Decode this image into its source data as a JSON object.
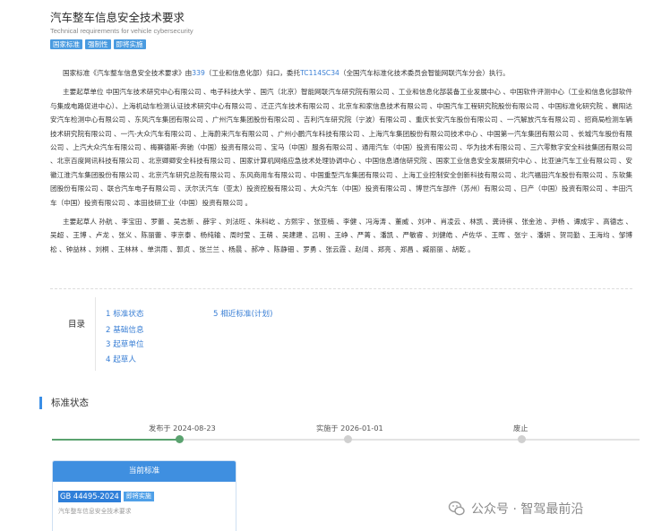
{
  "header": {
    "title_cn": "汽车整车信息安全技术要求",
    "title_en": "Technical requirements for vehicle cybersecurity",
    "tags": [
      "国家标准",
      "强制性",
      "即将实施"
    ]
  },
  "intro": {
    "p1_a": "国家标准《汽车整车信息安全技术要求》由",
    "p1_tc": "339",
    "p1_b": "（工业和信息化部）归口，委托",
    "p1_tc2": "TC114SC34",
    "p1_c": "（全国汽车标准化技术委员会智能网联汽车分会）执行。",
    "p2": "主要起草单位 中国汽车技术研究中心有限公司 、电子科技大学 、国汽（北京）智能网联汽车研究院有限公司 、工业和信息化部装备工业发展中心 、中国软件评测中心（工业和信息化部软件与集成电路促进中心）、上海机动车检测认证技术研究中心有限公司 、迁正汽车技术有限公司 、北京车和家信息技术有限公司 、中国汽车工程研究院股份有限公司 、中国标准化研究院 、襄阳达安汽车检测中心有限公司 、东风汽车集团有限公司 、广州汽车集团股份有限公司 、吉利汽车研究院（宁波）有限公司 、重庆长安汽车股份有限公司 、一汽解放汽车有限公司 、招商局检测车辆技术研究院有限公司 、一汽-大众汽车有限公司 、上海蔚来汽车有限公司 、广州小鹏汽车科技有限公司 、上海汽车集团股份有限公司技术中心 、中国第一汽车集团有限公司 、长城汽车股份有限公司 、上汽大众汽车有限公司 、梅赛德斯-奔驰（中国）投资有限公司 、宝马（中国）服务有限公司 、通用汽车（中国）投资有限公司 、华为技术有限公司 、三六零数字安全科技集团有限公司 、北京百度网讯科技有限公司 、北京卿卿安全科技有限公司 、国家计算机网络应急技术处理协调中心 、中国信息通信研究院 、国家工业信息安全发展研究中心 、比亚迪汽车工业有限公司 、安徽江淮汽车集团股份有限公司 、北京汽车研究总院有限公司 、东风商用车有限公司 、中国重型汽车集团有限公司 、上海工业控制安全创新科技有限公司 、北汽福田汽车股份有限公司 、东软集团股份有限公司 、联合汽车电子有限公司 、沃尔沃汽车（亚太）投资控股有限公司 、大众汽车（中国）投资有限公司 、博世汽车部件（苏州）有限公司 、日产（中国）投资有限公司 、丰田汽车（中国）投资有限公司 、本田技研工业（中国）投资有限公司 。",
    "p3": "主要起草人 孙航 、李宝田 、罗蕾 、吴志新 、薛宇 、刘法旺 、朱科屹 、方熙宇 、张亚楠 、李健 、冯海涛 、董威 、刘冲 、肖凌云 、林凯 、龚诗祺 、张金池 、尹杨 、谭成宇 、高德志 、吴超 、王博 、卢龙 、张义 、陈丽蕾 、李京泰 、杨纯输 、周时莹 、王萌 、吴建建 、吕明 、王峥 、严菁 、潘凯 、严敏睿 、刘健皓 、卢佐华 、王晖 、张宁 、潘妍 、贺司勤 、王海均 、邹博松 、钟益林 、刘桐 、王林林 、单洪雨 、郭贞 、张兰兰 、杨晨 、郝冲 、陈静钿 、罗勇 、张云霞 、赵阔 、郑亮 、郑昌 、臧丽丽 、胡乾 。"
  },
  "toc": {
    "label": "目录",
    "items": [
      "1 标准状态",
      "2 基础信息",
      "3 起草单位",
      "4 起草人",
      "5 相近标准(计划)"
    ]
  },
  "status": {
    "title": "标准状态",
    "progress_fraction": 0.22,
    "steps": [
      {
        "label": "发布于 2024-08-23",
        "done": true
      },
      {
        "label": "实施于 2026-01-01",
        "done": false
      },
      {
        "label": "废止",
        "done": false
      }
    ]
  },
  "card": {
    "head": "当前标准",
    "code": "GB 44495-2024",
    "badge": "即将实施",
    "subtitle": "汽车整车信息安全技术要求"
  },
  "watermark": "公众号 · 智驾最前沿",
  "colors": {
    "accent": "#3f8fe0",
    "link": "#3a7fd5",
    "progress": "#5aa26f",
    "tag": "#4a9be0"
  }
}
